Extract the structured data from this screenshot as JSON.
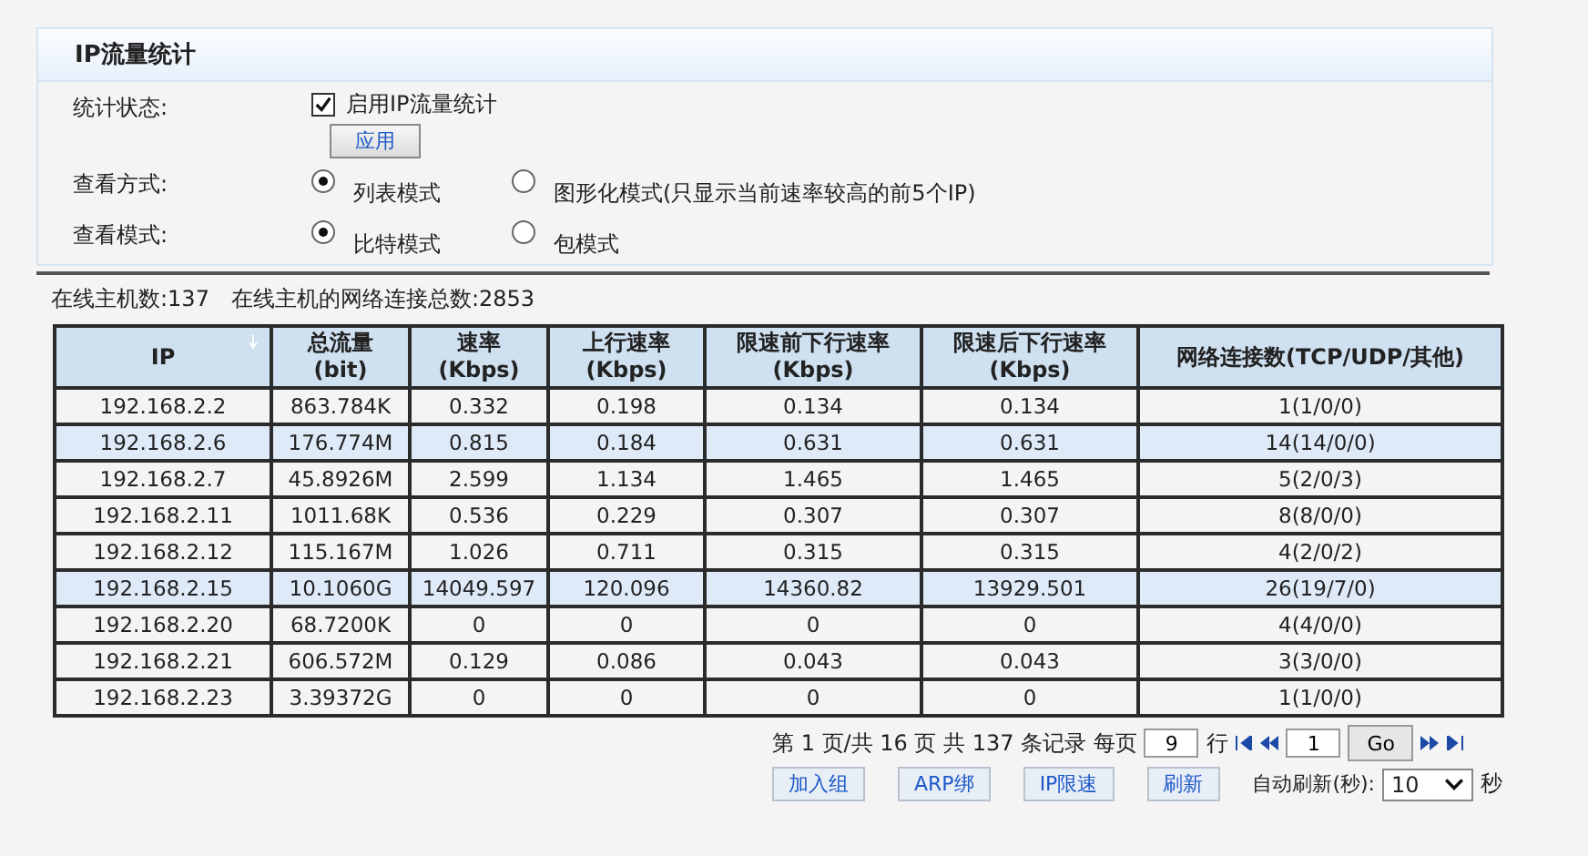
{
  "panel": {
    "title": "IP流量统计",
    "status": {
      "label": "统计状态:",
      "option": {
        "label": "启用IP流量统计",
        "checked": true
      },
      "apply_button": "应用"
    },
    "view_method": {
      "label": "查看方式:",
      "options": [
        {
          "label": "列表模式",
          "selected": true
        },
        {
          "label": "图形化模式(只显示当前速率较高的前5个IP)",
          "selected": false
        }
      ]
    },
    "view_mode": {
      "label": "查看模式:",
      "options": [
        {
          "label": "比特模式",
          "selected": true
        },
        {
          "label": "包模式",
          "selected": false
        }
      ]
    }
  },
  "summary": [
    "在线主机数:137",
    "在线主机的网络连接总数:2853"
  ],
  "table": {
    "columns": [
      {
        "title": "IP",
        "sorted": true
      },
      {
        "title": "总流量",
        "unit": "(bit)"
      },
      {
        "title": "速率",
        "unit": "(Kbps)"
      },
      {
        "title": "上行速率",
        "unit": "(Kbps)"
      },
      {
        "title": "限速前下行速率",
        "unit": "(Kbps)"
      },
      {
        "title": "限速后下行速率",
        "unit": "(Kbps)"
      },
      {
        "title": "网络连接数(TCP/UDP/其他)"
      }
    ],
    "rows": [
      {
        "highlighted": false,
        "cells": [
          "192.168.2.2",
          "863.784K",
          "0.332",
          "0.198",
          "0.134",
          "0.134",
          "1(1/0/0)"
        ]
      },
      {
        "highlighted": true,
        "cells": [
          "192.168.2.6",
          "176.774M",
          "0.815",
          "0.184",
          "0.631",
          "0.631",
          "14(14/0/0)"
        ]
      },
      {
        "highlighted": false,
        "cells": [
          "192.168.2.7",
          "45.8926M",
          "2.599",
          "1.134",
          "1.465",
          "1.465",
          "5(2/0/3)"
        ]
      },
      {
        "highlighted": false,
        "cells": [
          "192.168.2.11",
          "1011.68K",
          "0.536",
          "0.229",
          "0.307",
          "0.307",
          "8(8/0/0)"
        ]
      },
      {
        "highlighted": false,
        "cells": [
          "192.168.2.12",
          "115.167M",
          "1.026",
          "0.711",
          "0.315",
          "0.315",
          "4(2/0/2)"
        ]
      },
      {
        "highlighted": true,
        "cells": [
          "192.168.2.15",
          "10.1060G",
          "14049.597",
          "120.096",
          "14360.82",
          "13929.501",
          "26(19/7/0)"
        ]
      },
      {
        "highlighted": false,
        "cells": [
          "192.168.2.20",
          "68.7200K",
          "0",
          "0",
          "0",
          "0",
          "4(4/0/0)"
        ]
      },
      {
        "highlighted": false,
        "cells": [
          "192.168.2.21",
          "606.572M",
          "0.129",
          "0.086",
          "0.043",
          "0.043",
          "3(3/0/0)"
        ]
      },
      {
        "highlighted": false,
        "cells": [
          "192.168.2.23",
          "3.39372G",
          "0",
          "0",
          "0",
          "0",
          "1(1/0/0)"
        ]
      }
    ]
  },
  "pager": {
    "page_info": "第 1 页/共 16 页 共 137 条记录 每页",
    "per_page": "9",
    "rows_label": "行",
    "page": "1",
    "go_button": "Go"
  },
  "buttons": [
    "加入组",
    "ARP绑",
    "IP限速",
    "刷新"
  ],
  "auto_refresh": {
    "label": "自动刷新(秒):",
    "value": "10",
    "unit": "秒"
  }
}
